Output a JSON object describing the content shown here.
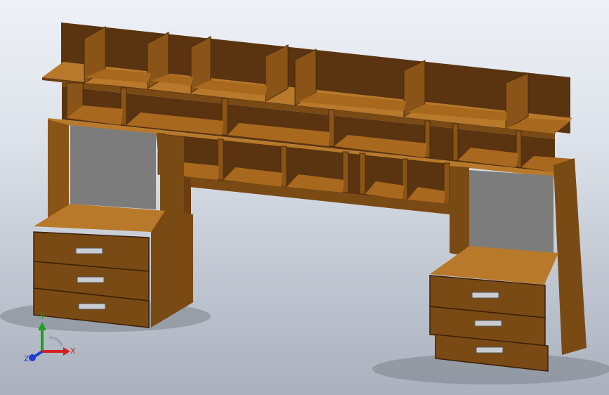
{
  "scene": {
    "background_top": "#eef1f6",
    "background_bottom": "#aab1bd",
    "wood_front": "#7a4a14",
    "wood_top": "#b87a2a",
    "wood_inner": "#5a3410",
    "panel_grey": "#7c7c7c",
    "handle": "#c9cdd3"
  },
  "triad": {
    "x_label": "X",
    "y_label": "Y",
    "z_label": "Z",
    "x_color": "#d42020",
    "y_color": "#20a020",
    "z_color": "#2040d0"
  }
}
